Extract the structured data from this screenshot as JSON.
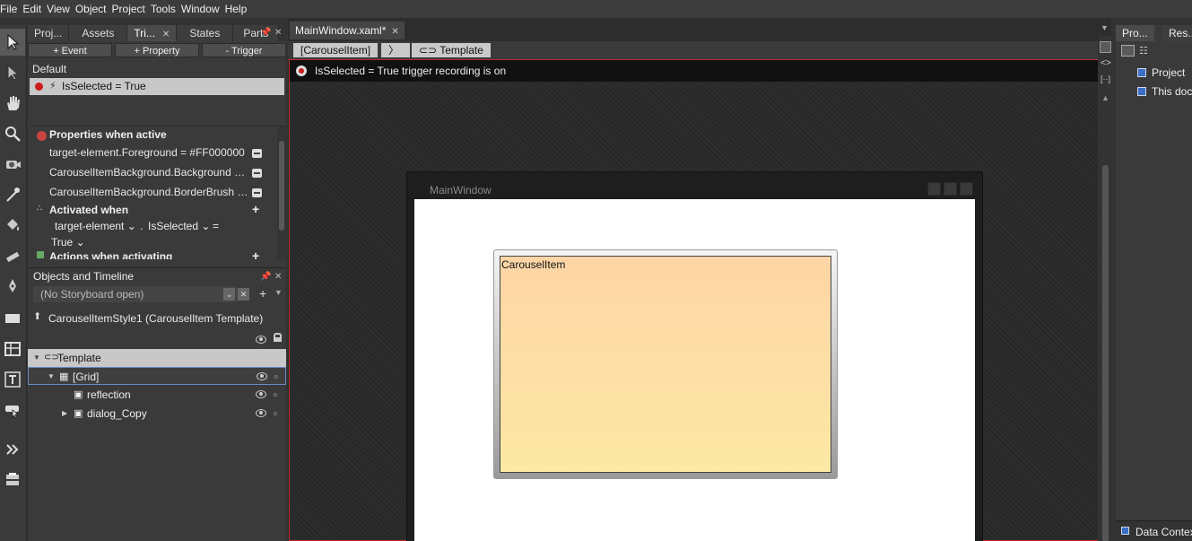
{
  "menu": [
    "File",
    "Edit",
    "View",
    "Object",
    "Project",
    "Tools",
    "Window",
    "Help"
  ],
  "left_tabs": [
    "Proj...",
    "Assets",
    "Tri...",
    "States",
    "Parts"
  ],
  "triggers": {
    "add_event": "+ Event",
    "add_property": "+ Property",
    "remove_trigger": "- Trigger",
    "default_label": "Default",
    "selected_trigger": "IsSelected = True"
  },
  "properties": {
    "header": "Properties when active",
    "rows": [
      "target-element.Foreground = #FF000000",
      "CarouselItemBackground.Background = S...",
      "CarouselItemBackground.BorderBrush =..."
    ],
    "activated_header": "Activated when",
    "cond_element": "target-element",
    "cond_dot": ".",
    "cond_property": "IsSelected",
    "cond_equals": "=",
    "cond_value": "True",
    "actions_header": "Actions when activating"
  },
  "objects": {
    "title": "Objects and Timeline",
    "storyboard": "(No Storyboard open)",
    "style_label": "CarouselItemStyle1 (CarouselItem Template)",
    "tree": [
      "Template",
      "[Grid]",
      "reflection",
      "dialog_Copy"
    ]
  },
  "document": {
    "tab_title": "MainWindow.xaml*",
    "crumb_item": "[CarouselItem]",
    "crumb_template": "Template",
    "recording_text": "IsSelected = True trigger recording is on",
    "window_title": "MainWindow",
    "carousel_caption": "CarouselItem"
  },
  "right": {
    "tabs": [
      "Pro...",
      "Res..."
    ],
    "items": [
      "Project",
      "This docu"
    ],
    "data_context": "Data Context"
  },
  "colors": {
    "recording_red": "#c61e1e",
    "carousel_top": "#fdd5a6",
    "carousel_bottom": "#fde8a4",
    "selection_blue": "#6a8ac4"
  }
}
